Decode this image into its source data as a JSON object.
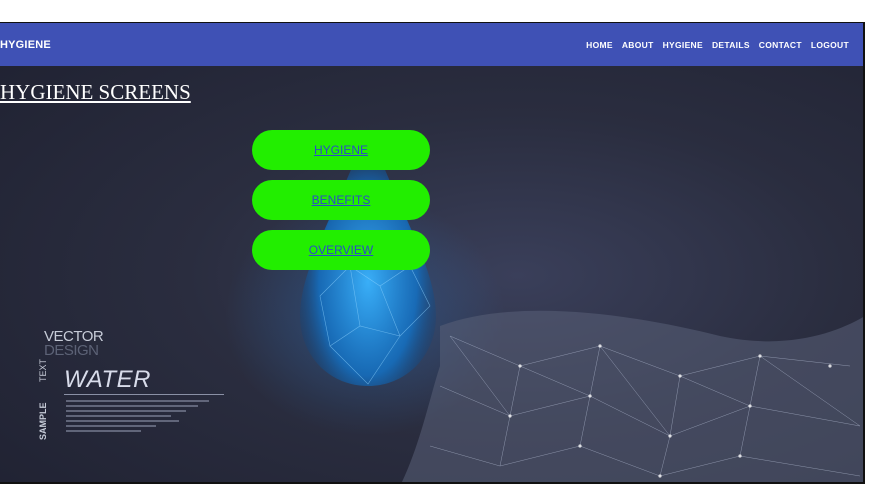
{
  "navbar": {
    "brand": "HYGIENE",
    "links": [
      "HOME",
      "ABOUT",
      "HYGIENE",
      "DETAILS",
      "CONTACT",
      "LOGOUT"
    ]
  },
  "page": {
    "title": "HYGIENE SCREENS"
  },
  "buttons": {
    "hygiene": "HYGIENE",
    "benefits": "BENEFITS",
    "overview": "OVERVIEW"
  },
  "hero": {
    "vector": "VECTOR",
    "design": "DESIGN",
    "water": "WATER",
    "text": "TEXT",
    "sample": "SAMPLE"
  },
  "colors": {
    "navbar": "#3f51b5",
    "button": "#22ee00",
    "link": "#2b4cc8"
  }
}
